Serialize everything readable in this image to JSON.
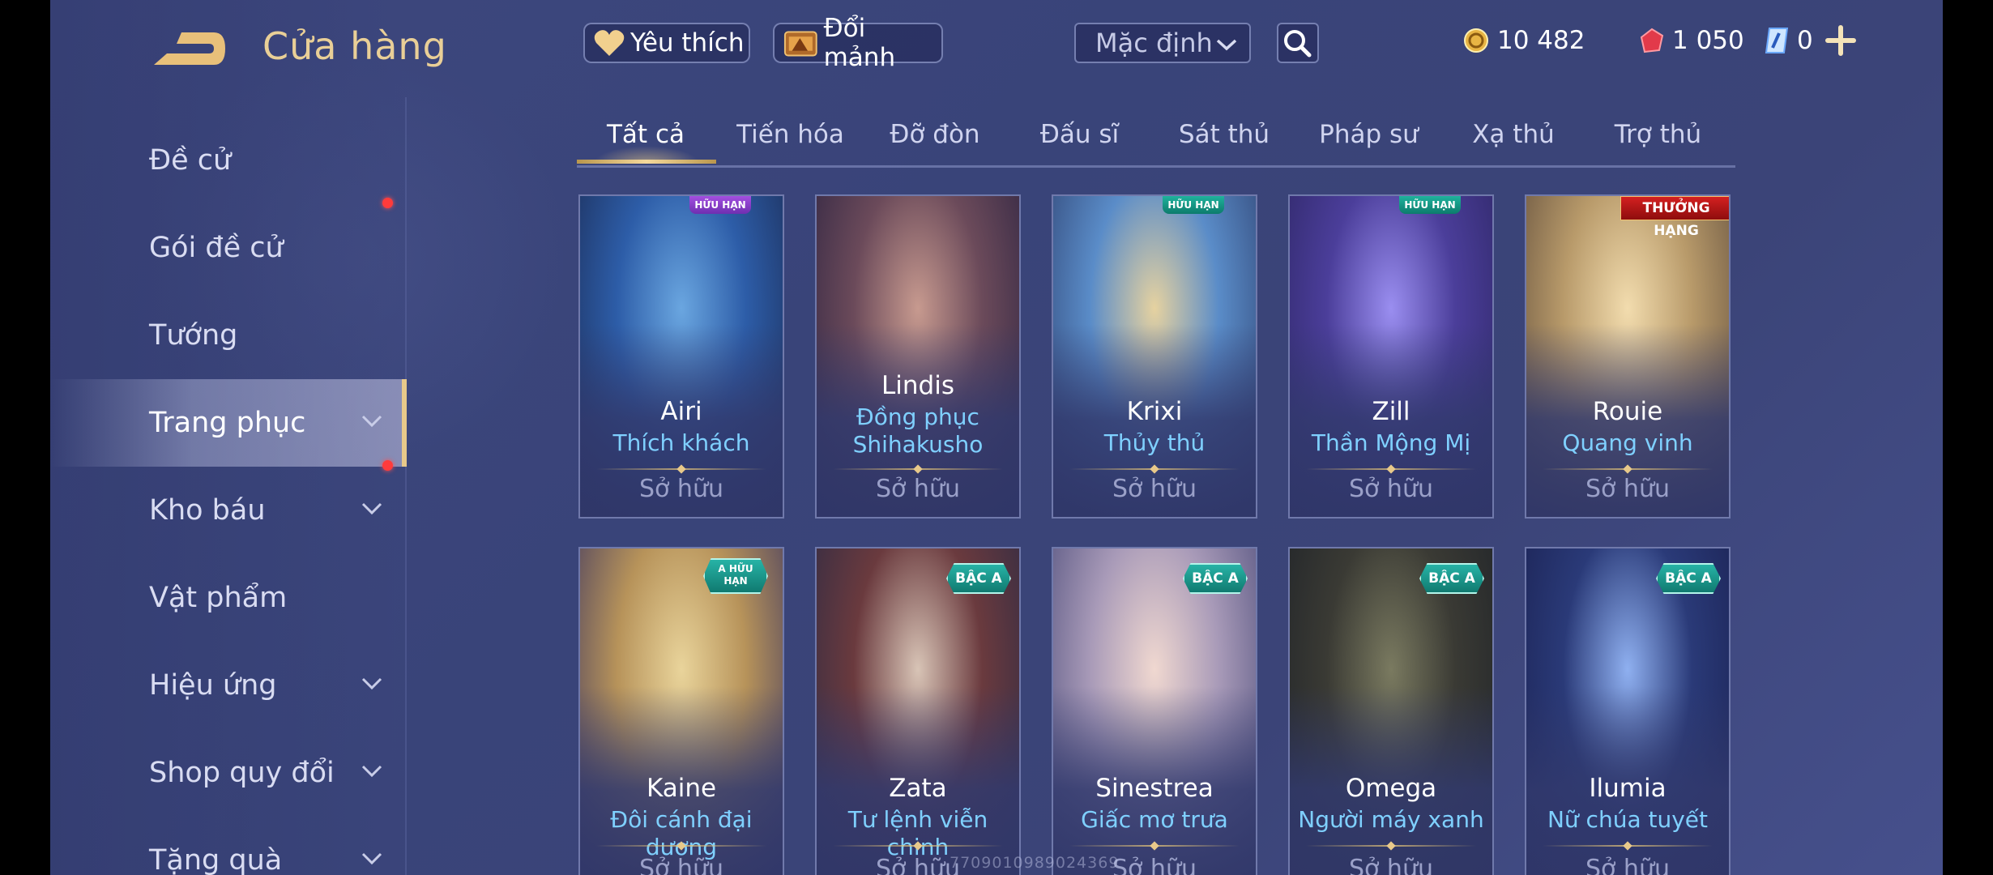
{
  "header": {
    "title": "Cửa hàng",
    "favorites_label": "Yêu thích",
    "exchange_label": "Đổi mảnh",
    "sort_selected": "Mặc định",
    "currencies": [
      {
        "name": "gold-coin-icon",
        "value": "10 482"
      },
      {
        "name": "ruby-icon",
        "value": "1 050"
      },
      {
        "name": "voucher-icon",
        "value": "0"
      }
    ]
  },
  "sidebar": {
    "items": [
      {
        "label": "Đề cử",
        "chevron": false,
        "dot": false,
        "active": false
      },
      {
        "label": "Gói đề cử",
        "chevron": false,
        "dot": true,
        "active": false
      },
      {
        "label": "Tướng",
        "chevron": false,
        "dot": false,
        "active": false
      },
      {
        "label": "Trang phục",
        "chevron": true,
        "dot": false,
        "active": true
      },
      {
        "label": "Kho báu",
        "chevron": true,
        "dot": true,
        "active": false
      },
      {
        "label": "Vật phẩm",
        "chevron": false,
        "dot": false,
        "active": false
      },
      {
        "label": "Hiệu ứng",
        "chevron": true,
        "dot": false,
        "active": false
      },
      {
        "label": "Shop quy đổi",
        "chevron": true,
        "dot": false,
        "active": false
      },
      {
        "label": "Tặng quà",
        "chevron": true,
        "dot": false,
        "active": false
      }
    ]
  },
  "tabs": [
    "Tất cả",
    "Tiến hóa",
    "Đỡ đòn",
    "Đấu sĩ",
    "Sát thủ",
    "Pháp sư",
    "Xạ thủ",
    "Trợ thủ"
  ],
  "active_tab": "Tất cả",
  "cards_row1": [
    {
      "hero": "Airi",
      "skin": "Thích khách",
      "status": "Sở hữu",
      "badge": "HỮU HẠN"
    },
    {
      "hero": "Lindis",
      "skin": "Đồng phục Shihakusho",
      "status": "Sở hữu",
      "badge": ""
    },
    {
      "hero": "Krixi",
      "skin": "Thủy thủ",
      "status": "Sở hữu",
      "badge": "HỮU HẠN"
    },
    {
      "hero": "Zill",
      "skin": "Thần Mộng Mị",
      "status": "Sở hữu",
      "badge": "HỮU HẠN"
    },
    {
      "hero": "Rouie",
      "skin": "Quang vinh",
      "status": "Sở hữu",
      "badge": "THƯỞNG HẠNG"
    }
  ],
  "cards_row2": [
    {
      "hero": "Kaine",
      "skin": "Đôi cánh đại dương",
      "status": "Sở hữu",
      "badge": "A HỮU HẠN"
    },
    {
      "hero": "Zata",
      "skin": "Tư lệnh viễn chinh",
      "status": "Sở hữu",
      "badge": "BẬC A"
    },
    {
      "hero": "Sinestrea",
      "skin": "Giấc mơ trưa",
      "status": "Sở hữu",
      "badge": "BẬC A"
    },
    {
      "hero": "Omega",
      "skin": "Người máy xanh",
      "status": "Sở hữu",
      "badge": "BẬC A"
    },
    {
      "hero": "Ilumia",
      "skin": "Nữ chúa tuyết",
      "status": "Sở hữu",
      "badge": "BẬC A"
    }
  ],
  "watermark": "7709010989024369",
  "colors": {
    "accent_gold": "#e9cf97",
    "skin_name": "#7fd0ff",
    "notification": "#ff3b3b"
  }
}
